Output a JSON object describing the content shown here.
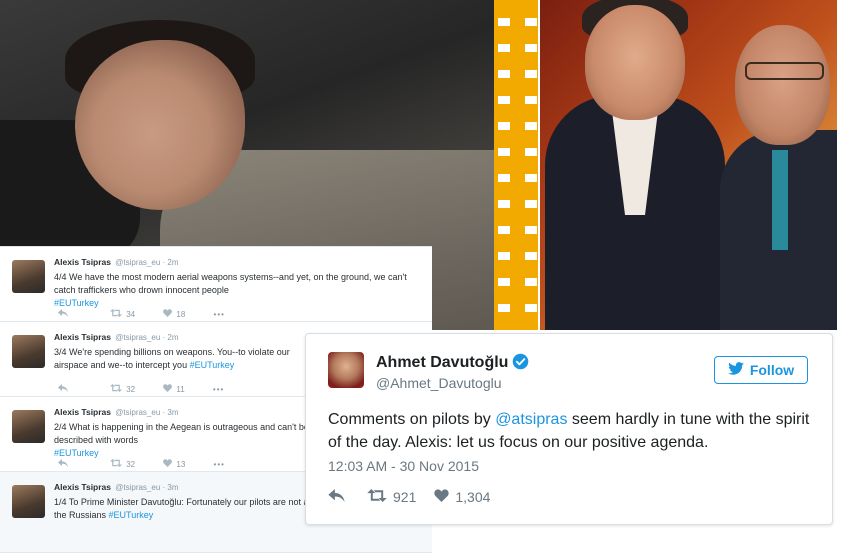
{
  "left_tweets": [
    {
      "name": "Alexis Tsipras",
      "handle": "@tsipras_eu",
      "time": "· 2m",
      "text": "4/4 We have the most modern aerial weapons systems--and yet, on the ground, we can't catch traffickers who drown innocent people",
      "hashtag": "#EUTurkey",
      "retweets": "34",
      "likes": "18",
      "more": "•••"
    },
    {
      "name": "Alexis Tsipras",
      "handle": "@tsipras_eu",
      "time": "· 2m",
      "text": "3/4 We're spending billions on weapons. You--to violate our airspace and we--to intercept you",
      "hashtag": "#EUTurkey",
      "retweets": "32",
      "likes": "11",
      "more": "•••"
    },
    {
      "name": "Alexis Tsipras",
      "handle": "@tsipras_eu",
      "time": "· 3m",
      "text": "2/4 What is happening in the Aegean is outrageous and can't be described with words",
      "hashtag": "#EUTurkey",
      "retweets": "32",
      "likes": "13",
      "more": "•••"
    },
    {
      "name": "Alexis Tsipras",
      "handle": "@tsipras_eu",
      "time": "· 3m",
      "text": "1/4 To Prime Minister Davutoğlu: Fortunately our pilots are not as mercurial as yours against the Russians",
      "hashtag": "#EUTurkey"
    }
  ],
  "card": {
    "name": "Ahmet Davutoğlu",
    "handle": "@Ahmet_Davutoglu",
    "follow_label": "Follow",
    "body_pre": "Comments on pilots by ",
    "mention": "@atsipras",
    "body_post": " seem hardly in tune with the spirit of the day. Alexis: let us focus on our positive agenda.",
    "timestamp": "12:03 AM - 30 Nov 2015",
    "retweets": "921",
    "likes": "1,304"
  },
  "colors": {
    "twitter_blue": "#1b95e0",
    "accent_yellow": "#f2a900",
    "text_dark": "#1c2022",
    "text_gray": "#697882"
  },
  "icons": [
    "reply-icon",
    "retweet-icon",
    "like-icon",
    "more-icon",
    "verified-icon",
    "twitter-bird-icon"
  ]
}
